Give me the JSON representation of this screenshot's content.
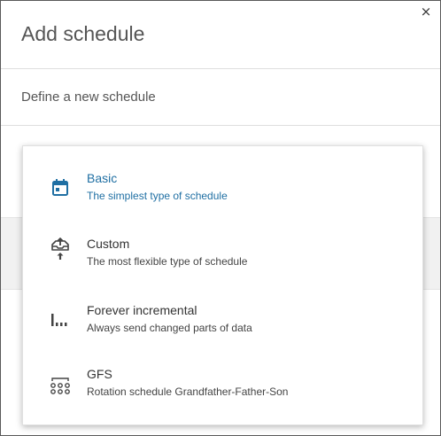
{
  "dialog": {
    "title": "Add schedule",
    "close_glyph": "×",
    "subtitle": "Define a new schedule"
  },
  "menu": {
    "items": [
      {
        "label": "Basic",
        "description": "The simplest type of schedule",
        "icon": "calendar-icon",
        "selected": true
      },
      {
        "label": "Custom",
        "description": "The most flexible type of schedule",
        "icon": "upload-tray-icon",
        "selected": false
      },
      {
        "label": "Forever incremental",
        "description": "Always send changed parts of data",
        "icon": "incremental-bars-icon",
        "selected": false
      },
      {
        "label": "GFS",
        "description": "Rotation schedule Grandfather-Father-Son",
        "icon": "hierarchy-icon",
        "selected": false
      }
    ]
  },
  "colors": {
    "accent": "#1f6fa3",
    "text": "#333333",
    "muted": "#555555"
  }
}
